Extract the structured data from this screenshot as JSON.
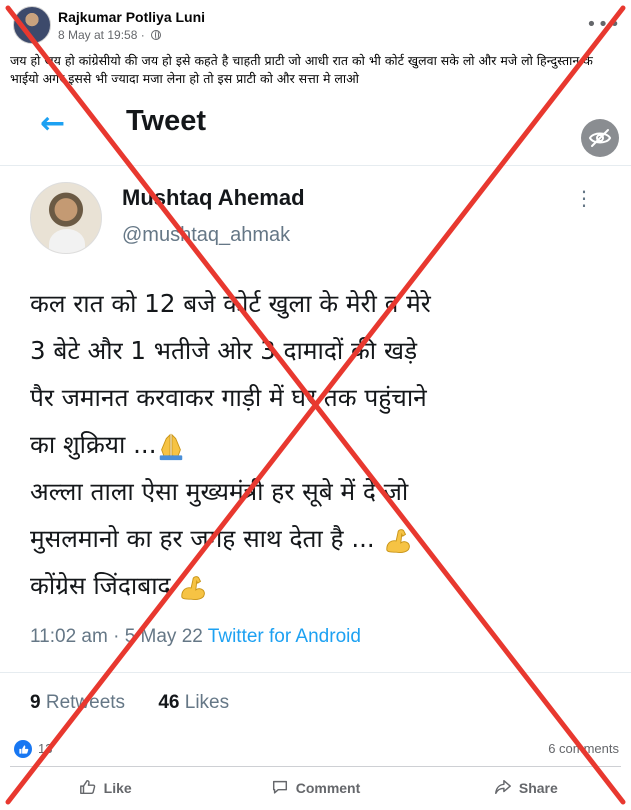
{
  "post": {
    "author": "Rajkumar Potliya Luni",
    "timestamp": "8 May at 19:58 ·",
    "privacy_icon": "globe-icon",
    "caption": "जय हो जय हो कांग्रेसीयो की जय हो इसे कहते है चाहती प्राटी जो आधी रात को भी कोर्ट खुलवा सके लो और मजे लो हिन्दुस्तान के भाईयो अगर इससे भी ज्यादा मजा लेना हो तो इस प्राटी को और सत्ता मे लाओ"
  },
  "tweet": {
    "header_title": "Tweet",
    "name": "Mushtaq Ahemad",
    "handle": "@mushtaq_ahmak",
    "lines": [
      "कल रात को 12 बजे कोर्ट खुला के मेरी व मेरे",
      "3 बेटे और 1 भतीजे ओर 3 दामादों की खड़े",
      "पैर जमानत करवाकर गाड़ी में घर तक पहुंचाने",
      "का शुक्रिया ...",
      "अल्ला ताला ऐसा मुख्यमंत्री हर सूबे में दे जो",
      "मुसलमानो का हर जगह साथ देता है ...",
      "कोंग्रेस जिंदाबाद"
    ],
    "time": "11:02 am · 5 May 22",
    "source": "Twitter for Android",
    "retweets_count": "9",
    "retweets_label": "Retweets",
    "likes_count": "46",
    "likes_label": "Likes"
  },
  "reactions": {
    "count": "13",
    "comments": "6 comments"
  },
  "actions": {
    "like": "Like",
    "comment": "Comment",
    "share": "Share"
  },
  "colors": {
    "twitter_blue": "#1da1f2",
    "facebook_blue": "#1877f2",
    "overlay_red": "#e8382f",
    "muted_text": "#65676b"
  }
}
